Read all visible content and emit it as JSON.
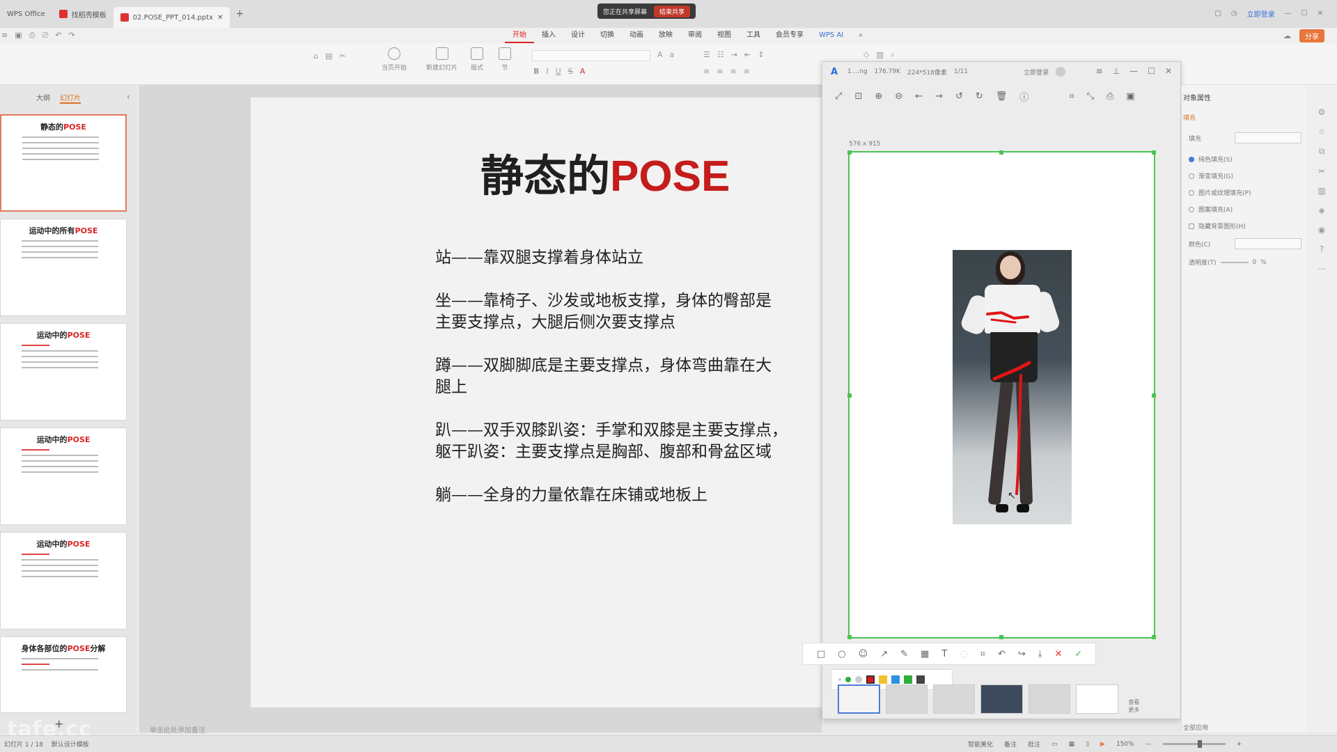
{
  "titlebar": {
    "app_tab": "WPS Office",
    "tabs": [
      {
        "label": "找稻壳模板",
        "color": "#d33"
      },
      {
        "label": "02.POSE_PPT_014.pptx",
        "color": "#d33"
      }
    ],
    "share_status": "您正在共享屏幕",
    "stop_share": "结束共享",
    "login": "立即登录"
  },
  "menu": {
    "items": [
      "开始",
      "插入",
      "设计",
      "切换",
      "动画",
      "放映",
      "审阅",
      "视图",
      "工具",
      "会员专享"
    ],
    "active": "开始",
    "wps_ai": "WPS AI",
    "share": "分享"
  },
  "ribbon": {
    "groups": [
      "当页开始",
      "新建幻灯片",
      "版式",
      "节"
    ]
  },
  "left_panel": {
    "tabs": [
      "大纲",
      "幻灯片"
    ],
    "active_tab": "幻灯片",
    "thumbnails": [
      {
        "title": "静态的",
        "highlight": "POSE"
      },
      {
        "title": "运动中的所有",
        "highlight": "POSE"
      },
      {
        "title": "运动中的",
        "highlight": "POSE"
      },
      {
        "title": "运动中的",
        "highlight": "POSE"
      },
      {
        "title": "运动中的",
        "highlight": "POSE"
      },
      {
        "title": "身体各部位的",
        "highlight": "POSE",
        "suffix": "分解"
      }
    ]
  },
  "slide": {
    "title_main": "静态的",
    "title_accent": "POSE",
    "paragraphs": [
      "站——靠双腿支撑着身体站立",
      "坐——靠椅子、沙发或地板支撑，身体的臀部是\n主要支撑点，大腿后侧次要支撑点",
      "蹲——双脚脚底是主要支撑点，身体弯曲靠在大\n腿上",
      "趴——双手双膝趴姿：手掌和双膝是主要支撑点，\n躯干趴姿：主要支撑点是胸部、腹部和骨盆区域",
      "躺——全身的力量依靠在床铺或地板上"
    ],
    "notes_placeholder": "单击此处添加备注"
  },
  "viewer": {
    "file_label": "1....ng",
    "file_size": "176.79K",
    "dimensions": "224*518像素",
    "index": "1/11",
    "login": "立即登录",
    "crop_size": "576 x 915",
    "film_label": "查看\n更多"
  },
  "props": {
    "title": "对象属性",
    "sub": "填充",
    "fill_label": "填充",
    "options": [
      "纯色填充(S)",
      "渐变填充(G)",
      "图片或纹理填充(P)",
      "图案填充(A)"
    ],
    "checkbox": "隐藏背景图形(H)",
    "color_label": "颜色(C)",
    "transparency_label": "透明度(T)",
    "transparency_value": "0",
    "transparency_unit": "%",
    "apply_all": "全部应用"
  },
  "statusbar": {
    "slide_count": "幻灯片 1 / 18",
    "template": "默认设计模板",
    "beautify": "智能美化",
    "notes": "备注",
    "comment": "批注",
    "zoom": "150%"
  },
  "colors": {
    "accent_red": "#d01e1e",
    "crop_green": "#4cc454",
    "tab_orange": "#e07020"
  }
}
